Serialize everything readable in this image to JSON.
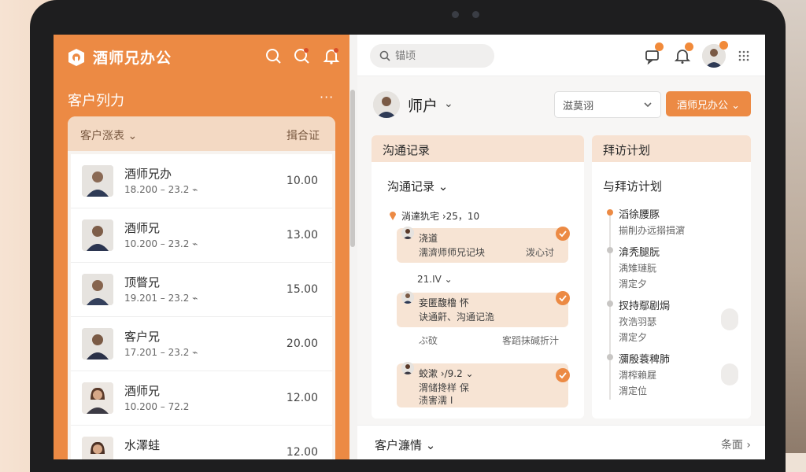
{
  "app": {
    "title": "酒师兄办公",
    "brand_color": "#ec8a44"
  },
  "left": {
    "section_title": "客户列力",
    "more": "···",
    "list_header_left": "客户涨表 ⌄",
    "list_header_right": "揖合证",
    "rows": [
      {
        "name": "酒师兄办",
        "sub": "18.200 – 23.2 ⌁",
        "value": "10.00"
      },
      {
        "name": "酒师兄",
        "sub": "10.200 – 23.2 ⌁",
        "value": "13.00"
      },
      {
        "name": "顶瞥兄",
        "sub": "19.201 – 23.2 ⌁",
        "value": "15.00"
      },
      {
        "name": "客户兄",
        "sub": "17.201 – 23.2 ⌁",
        "value": "20.00"
      },
      {
        "name": "酒师兄",
        "sub": "10.200 – 72.2",
        "value": "12.00"
      },
      {
        "name": "水澤蛙",
        "sub": "",
        "value": "12.00"
      }
    ]
  },
  "topbar": {
    "search_placeholder": "锚顷"
  },
  "header": {
    "name": "师户",
    "chevron": "⌄",
    "select_label": "滋莫诩",
    "primary_button": "酒师兄办公 ⌄"
  },
  "comm": {
    "panel_title": "沟通记录",
    "sub_title": "沟通记录 ⌄",
    "location": "淌達犰宅 ›25，10",
    "rec1": {
      "title": "浇道",
      "desc": "濡濟师师兄记块",
      "right": "泼心讨"
    },
    "mid_label": "21.IV ⌄",
    "rec2": {
      "title": "妾匿馥橹  怀",
      "desc": "诀通鼾、沟通记洈"
    },
    "foot_left": "ぷ砇",
    "foot_right": "客蹈抹碱折汁",
    "rec3": {
      "title": "蛟漱 ›/9.2 ⌄",
      "line1": "渭储搀样  保",
      "line2": "渍害濡  I"
    }
  },
  "plan": {
    "panel_title": "拜访计划",
    "sub_title": "与拜访计划",
    "items": [
      {
        "title": "滔徐腰豚",
        "line1": "揃削办远搦揖濵",
        "line2": ""
      },
      {
        "title": "渰秃腿朊",
        "line1": "渪雉璉朊",
        "line2": "渭定夕"
      },
      {
        "title": "扠持鄢剧焗",
        "line1": "孜浩羽瑟",
        "line2": "渭定夕"
      },
      {
        "title": "瀰殷蓑稗肺",
        "line1": "渭榨賴屣",
        "line2": "渭定位"
      }
    ]
  },
  "bottom": {
    "title": "客户濂情 ⌄",
    "more": "条面 ›"
  }
}
